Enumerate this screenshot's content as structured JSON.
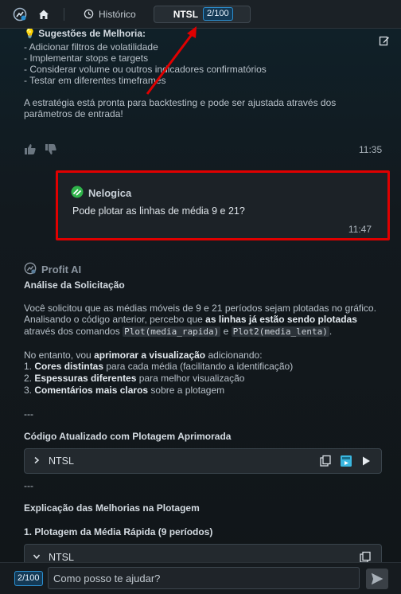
{
  "tabs": {
    "historico_label": "Histórico",
    "ntsl_label": "NTSL",
    "ntsl_badge": "2/100"
  },
  "assistant_prev": {
    "suggestions_title": "Sugestões de Melhoria:",
    "suggestions": [
      "- Adicionar filtros de volatilidade",
      "- Implementar stops e targets",
      "- Considerar volume ou outros indicadores confirmatórios",
      "- Testar em diferentes timeframes"
    ],
    "closing_line1": "A estratégia está pronta para backtesting e pode ser ajustada através dos",
    "closing_line2": "parâmetros de entrada!",
    "time": "11:35"
  },
  "user_message": {
    "name": "Nelogica",
    "text": "Pode plotar as linhas de média 9 e 21?",
    "time": "11:47"
  },
  "ai": {
    "name": "Profit AI",
    "analysis_title": "Análise da Solicitação",
    "p1_line1": "Você solicitou que as médias móveis de 9 e 21 períodos sejam plotadas no gráfico.",
    "p1_line2_start": "Analisando o código anterior, percebo que ",
    "p1_line2_bold": "as linhas já estão sendo plotadas",
    "p1_line3_start": "através dos comandos ",
    "p1_code1": "Plot(media_rapida)",
    "p1_and": " e ",
    "p1_code2": "Plot2(media_lenta)",
    "p1_end": ".",
    "p2_start": "No entanto, vou ",
    "p2_bold": "aprimorar a visualização",
    "p2_end": " adicionando:",
    "list": [
      {
        "num": "1. ",
        "bold": "Cores distintas",
        "rest": " para cada média (facilitando a identificação)"
      },
      {
        "num": "2. ",
        "bold": "Espessuras diferentes",
        "rest": " para melhor visualização"
      },
      {
        "num": "3. ",
        "bold": "Comentários mais claros",
        "rest": " sobre a plotagem"
      }
    ],
    "separator": "---",
    "code_title": "Código Atualizado com Plotagem Aprimorada",
    "code_label": "NTSL",
    "explanation_title": "Explicação das Melhorias na Plotagem",
    "sub_title": "1. Plotagem da Média Rápida (9 períodos)",
    "code2_label": "NTSL"
  },
  "input": {
    "badge": "2/100",
    "placeholder": "Como posso te ajudar?"
  },
  "colors": {
    "annotation_red": "#e00000",
    "badge_blue": "#2b8fd0",
    "nelogica_green": "#2fb34a"
  }
}
